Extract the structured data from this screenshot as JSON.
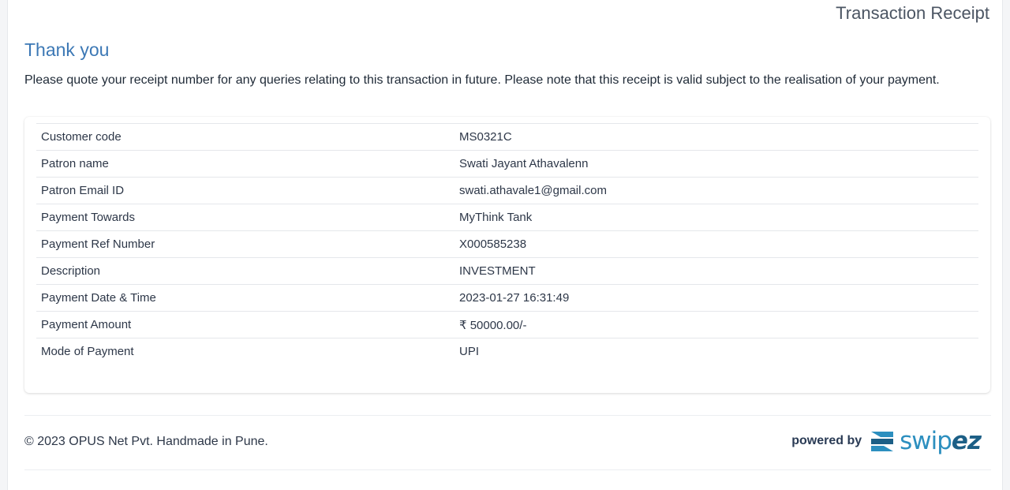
{
  "header": {
    "title": "Transaction Receipt"
  },
  "message": {
    "heading": "Thank you",
    "note": "Please quote your receipt number for any queries relating to this transaction in future. Please note that this receipt is valid subject to the realisation of your payment."
  },
  "details": [
    {
      "label": "Customer code",
      "value": "MS0321C"
    },
    {
      "label": "Patron name",
      "value": "Swati Jayant Athavalenn"
    },
    {
      "label": "Patron Email ID",
      "value": "swati.athavale1@gmail.com"
    },
    {
      "label": "Payment Towards",
      "value": "MyThink Tank"
    },
    {
      "label": "Payment Ref Number",
      "value": "X000585238"
    },
    {
      "label": "Description",
      "value": "INVESTMENT"
    },
    {
      "label": "Payment Date & Time",
      "value": "2023-01-27 16:31:49"
    },
    {
      "label": "Payment Amount",
      "value": "₹ 50000.00/-"
    },
    {
      "label": "Mode of Payment",
      "value": "UPI"
    }
  ],
  "footer": {
    "copyright": "© 2023 OPUS Net Pvt. Handmade in Pune.",
    "powered_by": "powered by",
    "logo_text_main": "swip",
    "logo_text_accent": "ez"
  },
  "colors": {
    "heading": "#3c78b5",
    "logo_blue": "#2c8fbf",
    "logo_dark": "#1c5f86"
  }
}
